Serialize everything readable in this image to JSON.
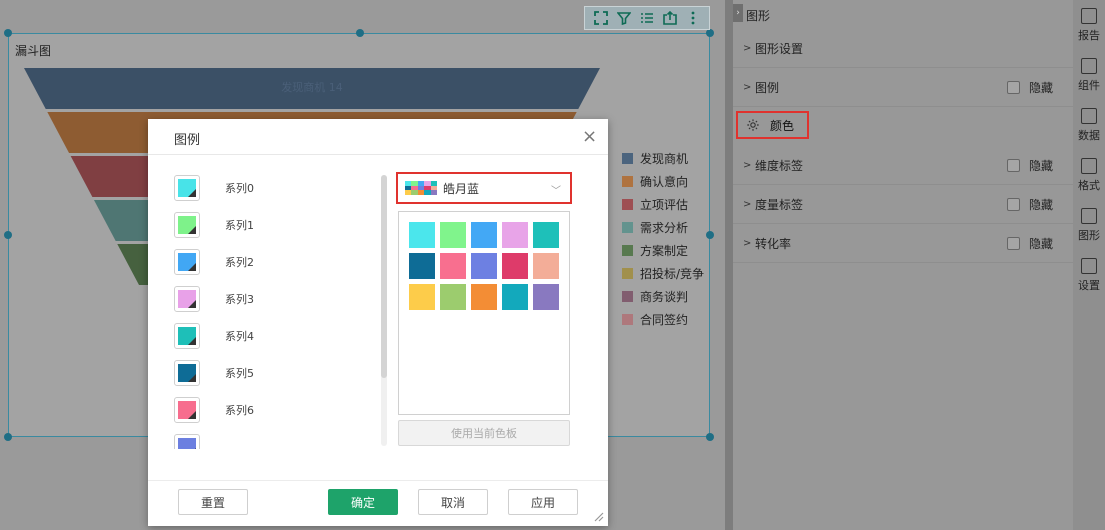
{
  "chart": {
    "title": "漏斗图",
    "funnel_label": "发现商机 14",
    "legend": [
      {
        "label": "发现商机",
        "color": "#2e4f72"
      },
      {
        "label": "确认意向",
        "color": "#b3631f"
      },
      {
        "label": "立项评估",
        "color": "#9c3338"
      },
      {
        "label": "需求分析",
        "color": "#4e8d87"
      },
      {
        "label": "方案制定",
        "color": "#3f6b33"
      },
      {
        "label": "招投标/竞争",
        "color": "#a08a2f"
      },
      {
        "label": "商务谈判",
        "color": "#76455d"
      },
      {
        "label": "合同签约",
        "color": "#b16a6f"
      }
    ]
  },
  "panel": {
    "title": "图形",
    "rows": [
      {
        "label": "图形设置",
        "has_checkbox": false
      },
      {
        "label": "图例",
        "has_checkbox": true,
        "checkbox_label": "隐藏"
      },
      {
        "label": "维度标签",
        "has_checkbox": true,
        "checkbox_label": "隐藏"
      },
      {
        "label": "度量标签",
        "has_checkbox": true,
        "checkbox_label": "隐藏"
      },
      {
        "label": "转化率",
        "has_checkbox": true,
        "checkbox_label": "隐藏"
      }
    ],
    "color_row_label": "颜色"
  },
  "tabs": [
    {
      "label": "报告",
      "icon": "report-icon"
    },
    {
      "label": "组件",
      "icon": "component-icon"
    },
    {
      "label": "数据",
      "icon": "data-icon"
    },
    {
      "label": "格式",
      "icon": "format-icon"
    },
    {
      "label": "图形",
      "icon": "chart-icon"
    },
    {
      "label": "设置",
      "icon": "settings-icon"
    }
  ],
  "modal": {
    "title": "图例",
    "series": [
      {
        "label": "系列0",
        "color": "#48e3e8"
      },
      {
        "label": "系列1",
        "color": "#7ef28a"
      },
      {
        "label": "系列2",
        "color": "#41a7f4"
      },
      {
        "label": "系列3",
        "color": "#e8a1e8"
      },
      {
        "label": "系列4",
        "color": "#1ebfb8"
      },
      {
        "label": "系列5",
        "color": "#0e6c96"
      },
      {
        "label": "系列6",
        "color": "#f76d8e"
      },
      {
        "label": "",
        "color": "#6c7fe0"
      }
    ],
    "palette_name": "皓月蓝",
    "palette_colors": [
      "#4be6ec",
      "#80f48c",
      "#43a8f5",
      "#e8a4e8",
      "#1ec0b9",
      "#0e6c96",
      "#f86f8f",
      "#6d80e2",
      "#de3b6a",
      "#f3ad98",
      "#fdcc4a",
      "#9ccc6e",
      "#f38d35",
      "#13a9bc",
      "#8979c0"
    ],
    "use_current_label": "使用当前色板",
    "buttons": {
      "reset": "重置",
      "ok": "确定",
      "cancel": "取消",
      "apply": "应用"
    }
  }
}
